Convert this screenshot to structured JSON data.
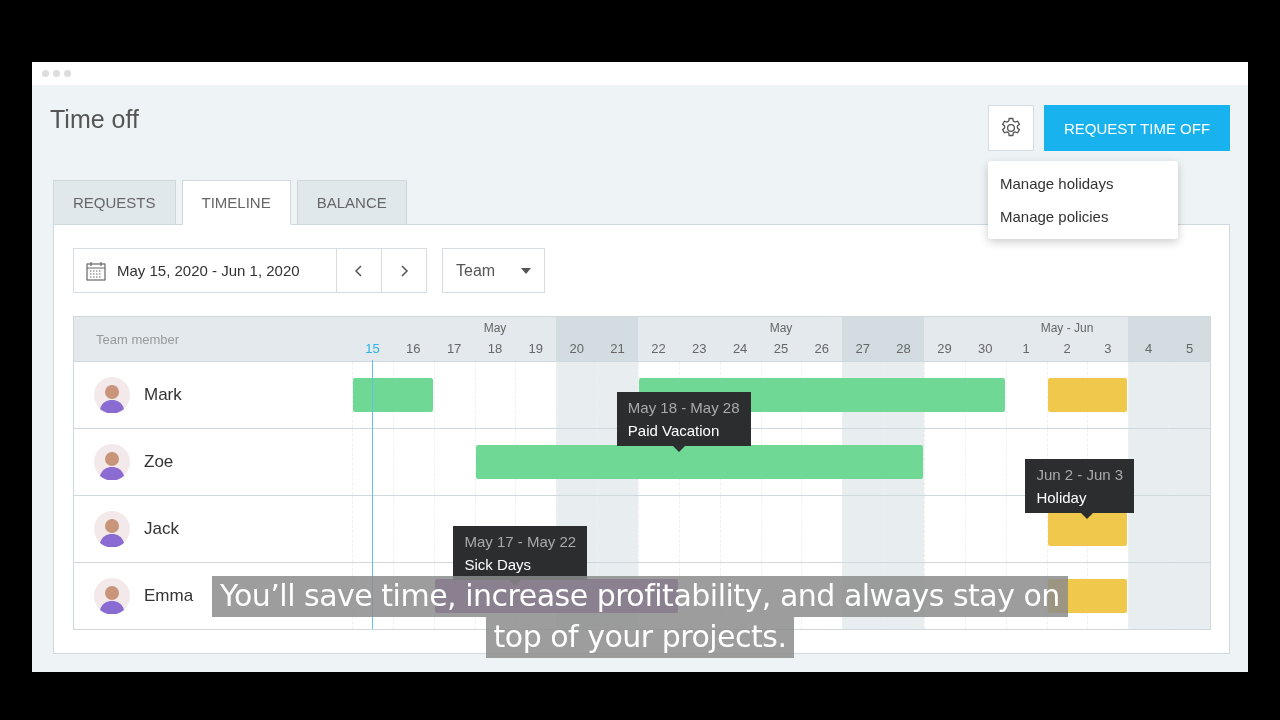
{
  "page": {
    "title": "Time off"
  },
  "actions": {
    "request_button": "REQUEST TIME OFF",
    "settings_menu": {
      "open": true,
      "items": [
        "Manage holidays",
        "Manage policies"
      ]
    }
  },
  "tabs": [
    {
      "label": "REQUESTS",
      "selected": false
    },
    {
      "label": "TIMELINE",
      "selected": true
    },
    {
      "label": "BALANCE",
      "selected": false
    }
  ],
  "toolbar": {
    "date_range": "May 15, 2020 - Jun 1, 2020",
    "filter": "Team"
  },
  "timeline": {
    "member_heading": "Team member",
    "days": [
      {
        "label": "15",
        "today": true,
        "weekend": false
      },
      {
        "label": "16",
        "today": false,
        "weekend": false
      },
      {
        "label": "17",
        "today": false,
        "weekend": false
      },
      {
        "label": "18",
        "month": "May",
        "today": false,
        "weekend": false
      },
      {
        "label": "19",
        "today": false,
        "weekend": false
      },
      {
        "label": "20",
        "today": false,
        "weekend": true
      },
      {
        "label": "21",
        "today": false,
        "weekend": true
      },
      {
        "label": "22",
        "today": false,
        "weekend": false
      },
      {
        "label": "23",
        "today": false,
        "weekend": false
      },
      {
        "label": "24",
        "today": false,
        "weekend": false
      },
      {
        "label": "25",
        "month": "May",
        "today": false,
        "weekend": false
      },
      {
        "label": "26",
        "today": false,
        "weekend": false
      },
      {
        "label": "27",
        "today": false,
        "weekend": true
      },
      {
        "label": "28",
        "today": false,
        "weekend": true
      },
      {
        "label": "29",
        "today": false,
        "weekend": false
      },
      {
        "label": "30",
        "today": false,
        "weekend": false
      },
      {
        "label": "1",
        "today": false,
        "weekend": false
      },
      {
        "label": "2",
        "month": "May - Jun",
        "today": false,
        "weekend": false
      },
      {
        "label": "3",
        "today": false,
        "weekend": false
      },
      {
        "label": "4",
        "today": false,
        "weekend": true
      },
      {
        "label": "5",
        "today": false,
        "weekend": true
      }
    ],
    "members": [
      {
        "name": "Mark",
        "days": [
          {
            "kind": "vacation"
          },
          {
            "kind": "vacation"
          },
          {
            "kind": "none"
          },
          {
            "kind": "none"
          },
          {
            "kind": "none"
          },
          {
            "kind": "none"
          },
          {
            "kind": "none"
          },
          {
            "kind": "vacation"
          },
          {
            "kind": "vacation"
          },
          {
            "kind": "vacation"
          },
          {
            "kind": "vacation"
          },
          {
            "kind": "vacation"
          },
          {
            "kind": "vacation"
          },
          {
            "kind": "vacation"
          },
          {
            "kind": "vacation"
          },
          {
            "kind": "vacation"
          },
          {
            "kind": "none"
          },
          {
            "kind": "holiday"
          },
          {
            "kind": "holiday"
          },
          {
            "kind": "none"
          },
          {
            "kind": "none"
          }
        ]
      },
      {
        "name": "Zoe",
        "days": [
          {
            "kind": "none"
          },
          {
            "kind": "none"
          },
          {
            "kind": "none"
          },
          {
            "kind": "vacation"
          },
          {
            "kind": "vacation"
          },
          {
            "kind": "vacation"
          },
          {
            "kind": "vacation"
          },
          {
            "kind": "vacation"
          },
          {
            "kind": "vacation",
            "tooltip": {
              "dates": "May 18 - May 28",
              "type": "Paid Vacation"
            }
          },
          {
            "kind": "vacation"
          },
          {
            "kind": "vacation"
          },
          {
            "kind": "vacation"
          },
          {
            "kind": "vacation"
          },
          {
            "kind": "vacation"
          },
          {
            "kind": "none"
          },
          {
            "kind": "none"
          },
          {
            "kind": "none"
          },
          {
            "kind": "none"
          },
          {
            "kind": "none"
          },
          {
            "kind": "none"
          },
          {
            "kind": "none"
          }
        ]
      },
      {
        "name": "Jack",
        "days": [
          {
            "kind": "none"
          },
          {
            "kind": "none"
          },
          {
            "kind": "none"
          },
          {
            "kind": "none"
          },
          {
            "kind": "none"
          },
          {
            "kind": "none"
          },
          {
            "kind": "none"
          },
          {
            "kind": "none"
          },
          {
            "kind": "none"
          },
          {
            "kind": "none"
          },
          {
            "kind": "none"
          },
          {
            "kind": "none"
          },
          {
            "kind": "none"
          },
          {
            "kind": "none"
          },
          {
            "kind": "none"
          },
          {
            "kind": "none"
          },
          {
            "kind": "none"
          },
          {
            "kind": "holiday"
          },
          {
            "kind": "holiday",
            "tooltip": {
              "dates": "Jun 2 - Jun 3",
              "type": "Holiday"
            }
          },
          {
            "kind": "none"
          },
          {
            "kind": "none"
          }
        ]
      },
      {
        "name": "Emma",
        "days": [
          {
            "kind": "none"
          },
          {
            "kind": "none"
          },
          {
            "kind": "sick"
          },
          {
            "kind": "sick"
          },
          {
            "kind": "sick",
            "tooltip": {
              "dates": "May 17 - May 22",
              "type": "Sick Days"
            }
          },
          {
            "kind": "sick"
          },
          {
            "kind": "sick"
          },
          {
            "kind": "sick"
          },
          {
            "kind": "none"
          },
          {
            "kind": "none"
          },
          {
            "kind": "none"
          },
          {
            "kind": "none"
          },
          {
            "kind": "none"
          },
          {
            "kind": "none"
          },
          {
            "kind": "none"
          },
          {
            "kind": "none"
          },
          {
            "kind": "none"
          },
          {
            "kind": "holiday"
          },
          {
            "kind": "holiday"
          },
          {
            "kind": "none"
          },
          {
            "kind": "none"
          }
        ]
      }
    ]
  },
  "subtitle": [
    "You’ll save time, increase profitability, and always stay on",
    "top of your projects."
  ]
}
